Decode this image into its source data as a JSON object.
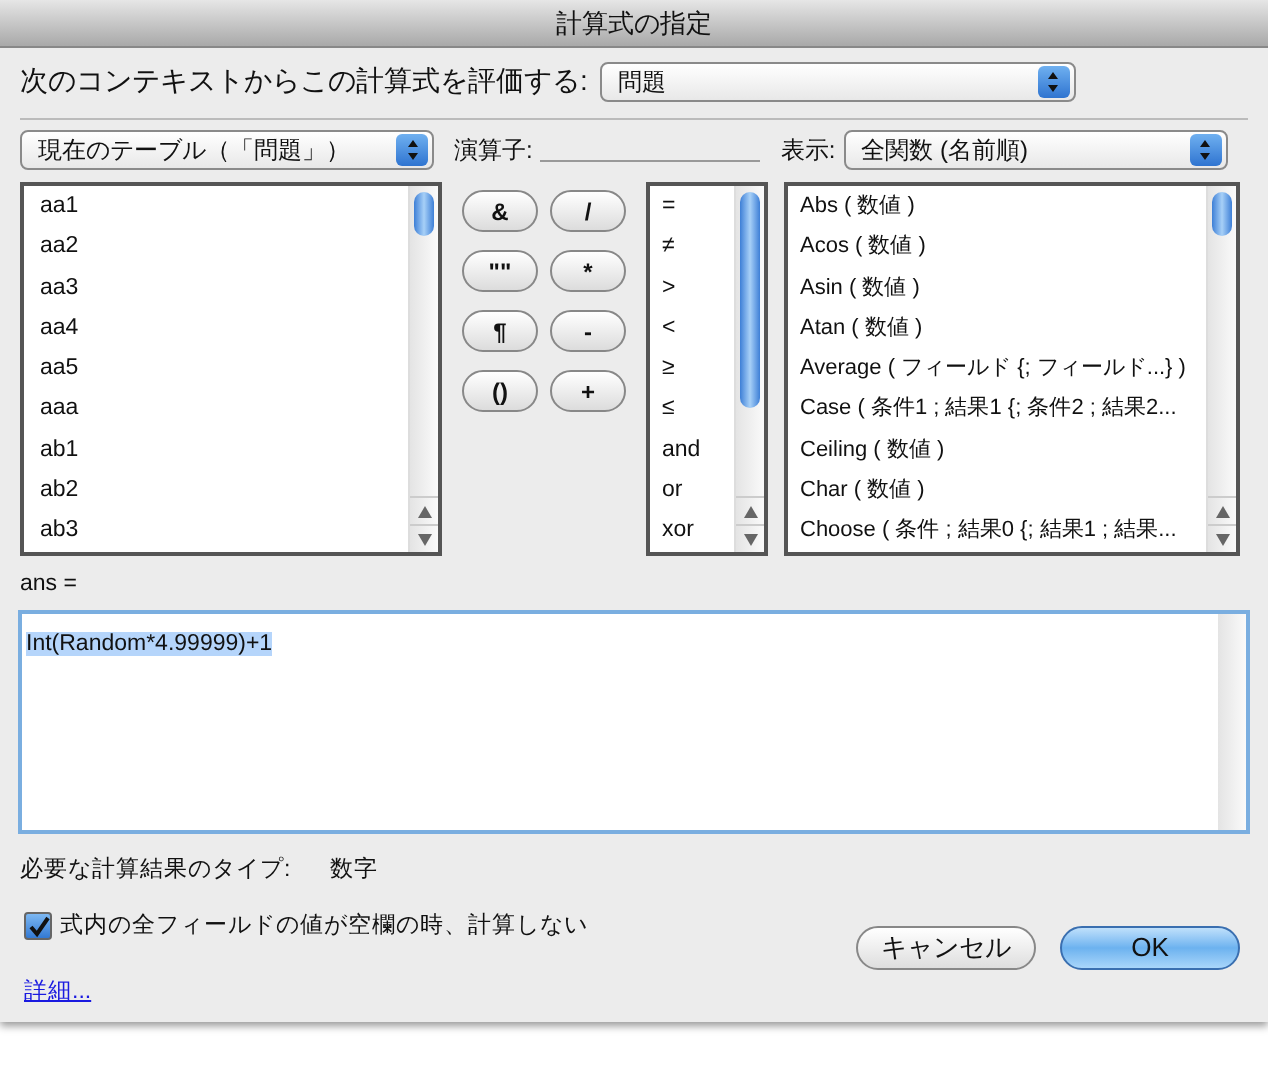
{
  "window": {
    "title": "計算式の指定"
  },
  "context": {
    "label": "次のコンテキストからこの計算式を評価する:",
    "value": "問題"
  },
  "table_popup": {
    "value": "現在のテーブル（「問題」）"
  },
  "operators_label": "演算子:",
  "view": {
    "label": "表示:",
    "value": "全関数 (名前順)"
  },
  "fields": [
    "aa1",
    "aa2",
    "aa3",
    "aa4",
    "aa5",
    "aaa",
    "ab1",
    "ab2",
    "ab3"
  ],
  "operator_buttons": [
    "&",
    "/",
    "\"\"",
    "*",
    "¶",
    "-",
    "()",
    "+"
  ],
  "operators": [
    "=",
    "≠",
    ">",
    "<",
    "≥",
    "≤",
    "and",
    "or",
    "xor"
  ],
  "functions": [
    "Abs ( 数値 )",
    "Acos ( 数値 )",
    "Asin ( 数値 )",
    "Atan ( 数値 )",
    "Average ( フィールド {; フィールド...} )",
    "Case ( 条件1 ; 結果1 {; 条件2 ; 結果2...",
    "Ceiling ( 数値 )",
    "Char ( 数値 )",
    "Choose ( 条件 ; 結果0 {; 結果1 ; 結果..."
  ],
  "formula": {
    "label": "ans =",
    "value": "Int(Random*4.99999)+1",
    "text_selected": true
  },
  "result_type": {
    "label": "必要な計算結果のタイプ:",
    "value": "数字"
  },
  "skip_empty": {
    "label": "式内の全フィールドの値が空欄の時、計算しない",
    "checked": true
  },
  "buttons": [
    {
      "label": "キャンセル",
      "kind": "normal"
    },
    {
      "label": "OK",
      "kind": "default"
    }
  ],
  "details_link": "詳細..."
}
